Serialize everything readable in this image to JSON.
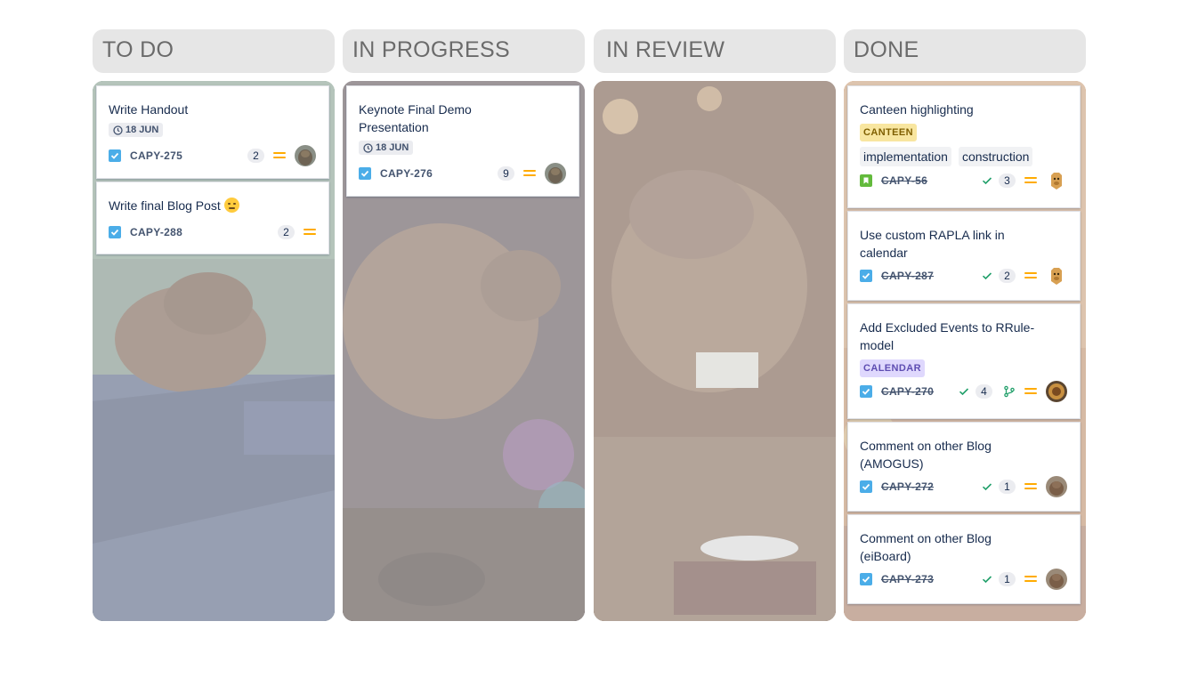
{
  "columns": [
    {
      "title": "TO DO",
      "cards": [
        {
          "title": "Write Handout",
          "date": "18 JUN",
          "key": "CAPY-275",
          "points": "2"
        },
        {
          "title": "Write final Blog Post",
          "key": "CAPY-288",
          "points": "2"
        }
      ]
    },
    {
      "title": "IN PROGRESS",
      "cards": [
        {
          "title": "Keynote Final Demo Presentation",
          "date": "18 JUN",
          "key": "CAPY-276",
          "points": "9"
        }
      ]
    },
    {
      "title": "IN REVIEW",
      "cards": []
    },
    {
      "title": "DONE",
      "cards": [
        {
          "title": "Canteen highlighting",
          "label": "CANTEEN",
          "tags": [
            "implementation",
            "construction"
          ],
          "key": "CAPY-56",
          "points": "3"
        },
        {
          "title": "Use custom RAPLA link in calendar",
          "key": "CAPY-287",
          "points": "2"
        },
        {
          "title": "Add Excluded Events to RRule-model",
          "label": "CALENDAR",
          "key": "CAPY-270",
          "points": "4"
        },
        {
          "title": "Comment on other Blog (AMOGUS)",
          "key": "CAPY-272",
          "points": "1"
        },
        {
          "title": "Comment on other Blog (eiBoard)",
          "key": "CAPY-273",
          "points": "1"
        }
      ]
    }
  ],
  "colors": {
    "priority_medium": "#ffab00",
    "task_icon": "#4bade8",
    "story_icon": "#63ba3c",
    "done_check": "#22a06b",
    "label_yellow": "#f8e6a0",
    "label_purple": "#dfd8fd"
  },
  "icons": {
    "task": "checkbox-icon",
    "story": "bookmark-icon",
    "date": "clock-icon",
    "done": "check-icon",
    "priority": "priority-medium-icon",
    "branch": "git-branch-icon"
  }
}
